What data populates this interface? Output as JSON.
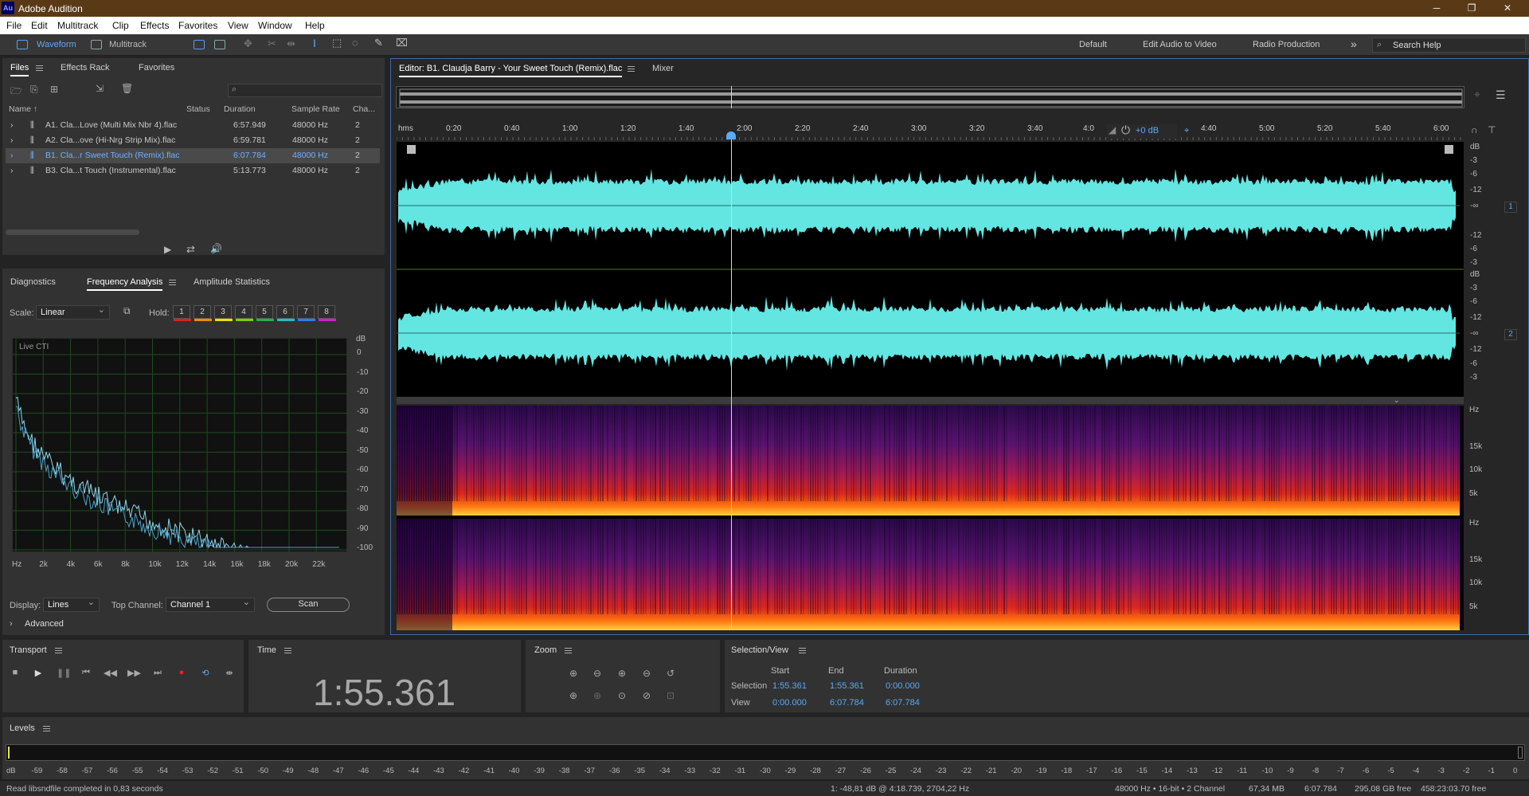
{
  "app": {
    "title": "Adobe Audition",
    "logo": "Au"
  },
  "menu": [
    "File",
    "Edit",
    "Multitrack",
    "Clip",
    "Effects",
    "Favorites",
    "View",
    "Window",
    "Help"
  ],
  "toolbar": {
    "waveform": "Waveform",
    "multitrack": "Multitrack",
    "workspaces": [
      "Default",
      "Edit Audio to Video",
      "Radio Production"
    ],
    "more": "»",
    "search_placeholder": "Search Help"
  },
  "files": {
    "tabs": [
      "Files",
      "Effects Rack",
      "Favorites"
    ],
    "columns": [
      "Name ↑",
      "Status",
      "Duration",
      "Sample Rate",
      "Cha..."
    ],
    "rows": [
      {
        "name": "A1. Cla...Love (Multi Mix Nbr 4).flac",
        "duration": "6:57.949",
        "rate": "48000 Hz",
        "ch": "2"
      },
      {
        "name": "A2. Cla...ove (Hi-Nrg Strip Mix).flac",
        "duration": "6:59.781",
        "rate": "48000 Hz",
        "ch": "2"
      },
      {
        "name": "B1. Cla...r Sweet Touch (Remix).flac",
        "duration": "6:07.784",
        "rate": "48000 Hz",
        "ch": "2"
      },
      {
        "name": "B3. Cla...t Touch (Instrumental).flac",
        "duration": "5:13.773",
        "rate": "48000 Hz",
        "ch": "2"
      }
    ]
  },
  "analysis": {
    "tabs": [
      "Diagnostics",
      "Frequency Analysis",
      "Amplitude Statistics"
    ],
    "scale_label": "Scale:",
    "scale_value": "Linear",
    "hold_label": "Hold:",
    "holds": [
      {
        "n": "1",
        "color": "#e02020"
      },
      {
        "n": "2",
        "color": "#f08c00"
      },
      {
        "n": "3",
        "color": "#e8e000"
      },
      {
        "n": "4",
        "color": "#7ad000"
      },
      {
        "n": "5",
        "color": "#22b14c"
      },
      {
        "n": "6",
        "color": "#22c0c0"
      },
      {
        "n": "7",
        "color": "#2a7ef0"
      },
      {
        "n": "8",
        "color": "#d020d0"
      }
    ],
    "live_cti": "Live CTI",
    "db_unit": "dB",
    "db_ticks": [
      "0",
      "-10",
      "-20",
      "-30",
      "-40",
      "-50",
      "-60",
      "-70",
      "-80",
      "-90",
      "-100"
    ],
    "hz_ticks": [
      "Hz",
      "2k",
      "4k",
      "6k",
      "8k",
      "10k",
      "12k",
      "14k",
      "16k",
      "18k",
      "20k",
      "22k"
    ],
    "display_label": "Display:",
    "display_value": "Lines",
    "top_channel_label": "Top Channel:",
    "top_channel_value": "Channel 1",
    "scan": "Scan",
    "advanced": "Advanced"
  },
  "editor": {
    "tab": "Editor: B1. Claudja Barry - Your Sweet Touch (Remix).flac",
    "mixer": "Mixer",
    "ruler": [
      "hms",
      "0:20",
      "0:40",
      "1:00",
      "1:20",
      "1:40",
      "2:00",
      "2:20",
      "2:40",
      "3:00",
      "3:20",
      "3:40",
      "4:0",
      "4:40",
      "5:00",
      "5:20",
      "5:40",
      "6:00"
    ],
    "volume": "+0 dB",
    "db_scale_ch1": [
      "dB",
      "-3",
      "-6",
      "-12",
      "-∞",
      "-12",
      "-6",
      "-3"
    ],
    "db_scale_ch2": [
      "dB",
      "-3",
      "-6",
      "-12",
      "-∞",
      "-12",
      "-6",
      "-3"
    ],
    "ch1": "1",
    "ch2": "2",
    "hz_scale": [
      "Hz",
      "15k",
      "10k",
      "5k"
    ]
  },
  "transport": {
    "title": "Transport"
  },
  "time": {
    "title": "Time",
    "value": "1:55.361"
  },
  "zoom": {
    "title": "Zoom"
  },
  "selection": {
    "title": "Selection/View",
    "start": "Start",
    "end": "End",
    "duration": "Duration",
    "sel_label": "Selection",
    "view_label": "View",
    "sel_start": "1:55.361",
    "sel_end": "1:55.361",
    "sel_dur": "0:00.000",
    "view_start": "0:00.000",
    "view_end": "6:07.784",
    "view_dur": "6:07.784"
  },
  "levels": {
    "title": "Levels",
    "ticks": [
      "dB",
      "-59",
      "-58",
      "-57",
      "-56",
      "-55",
      "-54",
      "-53",
      "-52",
      "-51",
      "-50",
      "-49",
      "-48",
      "-47",
      "-46",
      "-45",
      "-44",
      "-43",
      "-42",
      "-41",
      "-40",
      "-39",
      "-38",
      "-37",
      "-36",
      "-35",
      "-34",
      "-33",
      "-32",
      "-31",
      "-30",
      "-29",
      "-28",
      "-27",
      "-26",
      "-25",
      "-24",
      "-23",
      "-22",
      "-21",
      "-20",
      "-19",
      "-18",
      "-17",
      "-16",
      "-15",
      "-14",
      "-13",
      "-12",
      "-11",
      "-10",
      "-9",
      "-8",
      "-7",
      "-6",
      "-5",
      "-4",
      "-3",
      "-2",
      "-1",
      "0"
    ]
  },
  "status": {
    "left": "Read libsndfile completed in 0,83 seconds",
    "cursor": "1: -48,81 dB @ 4:18.739, 2704,22 Hz",
    "format": "48000 Hz • 16-bit • 2 Channel",
    "size": "67,34 MB",
    "duration": "6:07.784",
    "free": "295,08 GB free",
    "free_time": "458:23:03.70 free"
  },
  "colors": {
    "accent": "#5aa9f7",
    "waveform": "#63e6e2",
    "playhead": "#e8e840",
    "title_bar": "#5a3a16"
  }
}
